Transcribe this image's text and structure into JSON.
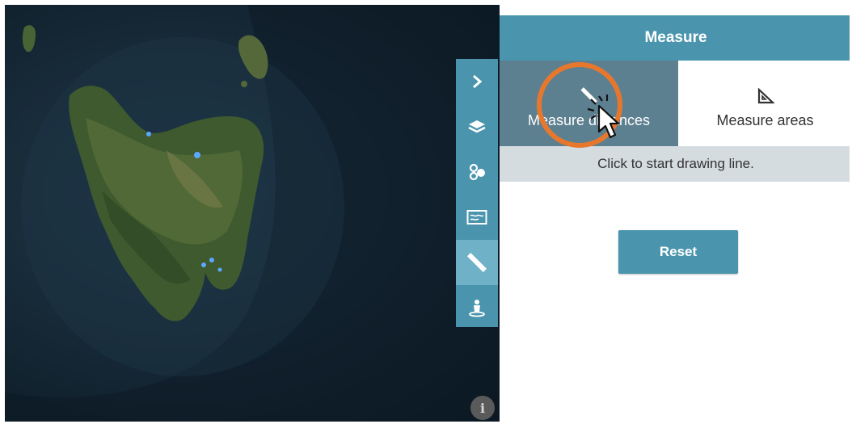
{
  "panel": {
    "title": "Measure",
    "tabs": [
      {
        "label": "Measure distances",
        "icon": "ruler-icon",
        "active": true
      },
      {
        "label": "Measure areas",
        "icon": "set-square-icon",
        "active": false
      }
    ],
    "hint": "Click to start drawing line.",
    "reset_label": "Reset"
  },
  "toolbar": {
    "items": [
      {
        "icon": "chevron-right-icon",
        "label": "Collapse panel"
      },
      {
        "icon": "layers-icon",
        "label": "Layers"
      },
      {
        "icon": "legend-icon",
        "label": "Legend"
      },
      {
        "icon": "basemap-icon",
        "label": "Basemaps"
      },
      {
        "icon": "ruler-icon",
        "label": "Measure",
        "active": true
      },
      {
        "icon": "location-icon",
        "label": "Location"
      }
    ]
  },
  "map": {
    "info_icon": "info-icon",
    "info_glyph": "i"
  },
  "colors": {
    "accent": "#4a95ad",
    "active_tab": "#5d8090",
    "active_tool": "#6fb2c7",
    "hint_bar": "#d4dce0",
    "highlight_circle": "#e8772e"
  }
}
